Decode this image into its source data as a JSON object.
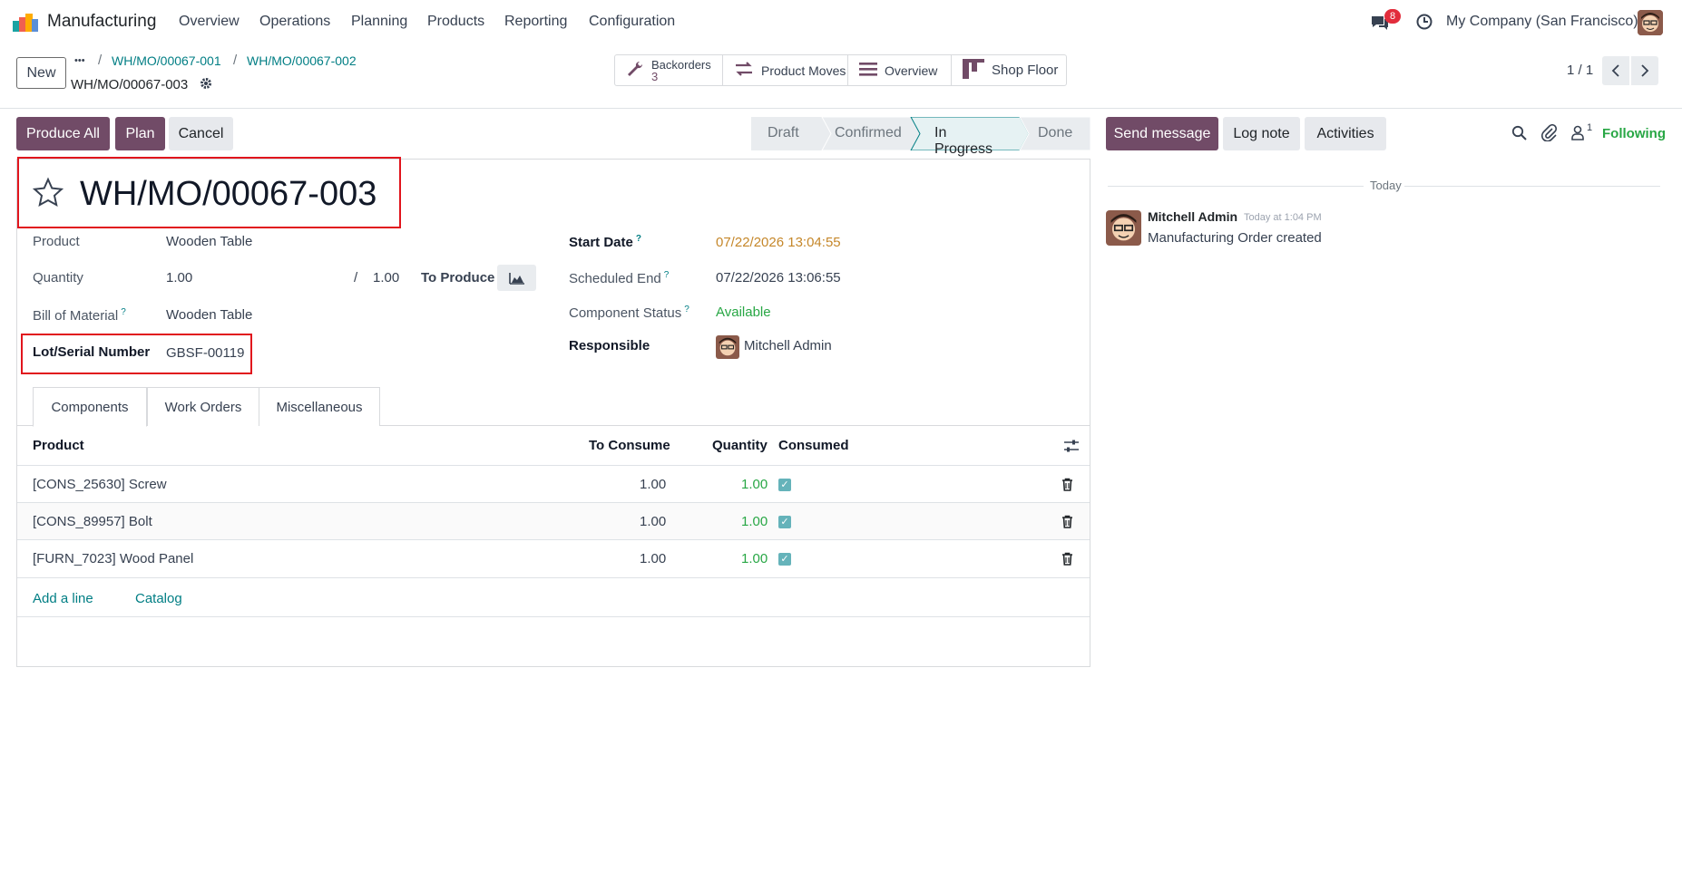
{
  "nav": {
    "app_name": "Manufacturing",
    "menus": [
      "Overview",
      "Operations",
      "Planning",
      "Products",
      "Reporting",
      "Configuration"
    ],
    "messages_badge": "8",
    "company": "My Company (San Francisco)"
  },
  "control": {
    "new_label": "New",
    "breadcrumb_ellipsis": "•••",
    "breadcrumb": [
      "WH/MO/00067-001",
      "WH/MO/00067-002"
    ],
    "current_record": "WH/MO/00067-003",
    "smart_buttons": {
      "backorders_label": "Backorders",
      "backorders_count": "3",
      "product_moves": "Product Moves",
      "overview": "Overview",
      "shop_floor": "Shop Floor"
    },
    "pager": "1 / 1"
  },
  "actions": {
    "produce_all": "Produce All",
    "plan": "Plan",
    "cancel": "Cancel"
  },
  "status": {
    "stages": [
      "Draft",
      "Confirmed",
      "In Progress",
      "Done"
    ],
    "current": "In Progress"
  },
  "form": {
    "title": "WH/MO/00067-003",
    "product_label": "Product",
    "product_value": "Wooden Table",
    "quantity_label": "Quantity",
    "quantity_value": "1.00",
    "quantity_separator": "/",
    "quantity_produced": "1.00",
    "to_produce_label": "To Produce",
    "bom_label": "Bill of Material",
    "bom_value": "Wooden Table",
    "lot_label": "Lot/Serial Number",
    "lot_value": "GBSF-00119",
    "start_date_label": "Start Date",
    "start_date_value": "07/22/2026 13:04:55",
    "scheduled_end_label": "Scheduled End",
    "scheduled_end_value": "07/22/2026 13:06:55",
    "component_status_label": "Component Status",
    "component_status_value": "Available",
    "responsible_label": "Responsible",
    "responsible_value": "Mitchell Admin",
    "help_mark": "?"
  },
  "tabs": [
    "Components",
    "Work Orders",
    "Miscellaneous"
  ],
  "table": {
    "headers": [
      "Product",
      "To Consume",
      "Quantity",
      "Consumed"
    ],
    "rows": [
      {
        "product": "[CONS_25630] Screw",
        "to_consume": "1.00",
        "quantity": "1.00"
      },
      {
        "product": "[CONS_89957] Bolt",
        "to_consume": "1.00",
        "quantity": "1.00"
      },
      {
        "product": "[FURN_7023] Wood Panel",
        "to_consume": "1.00",
        "quantity": "1.00"
      }
    ],
    "add_line": "Add a line",
    "catalog": "Catalog"
  },
  "chatter": {
    "send_message": "Send message",
    "log_note": "Log note",
    "activities": "Activities",
    "followers_count": "1",
    "following": "Following",
    "date_divider": "Today",
    "message": {
      "author": "Mitchell Admin",
      "time": "Today at 1:04 PM",
      "body": "Manufacturing Order created"
    }
  },
  "colors": {
    "primary": "#714b67",
    "link": "#017e84",
    "date_warning": "#c5872a",
    "success": "#28a745",
    "highlight_box": "#e1151d"
  }
}
